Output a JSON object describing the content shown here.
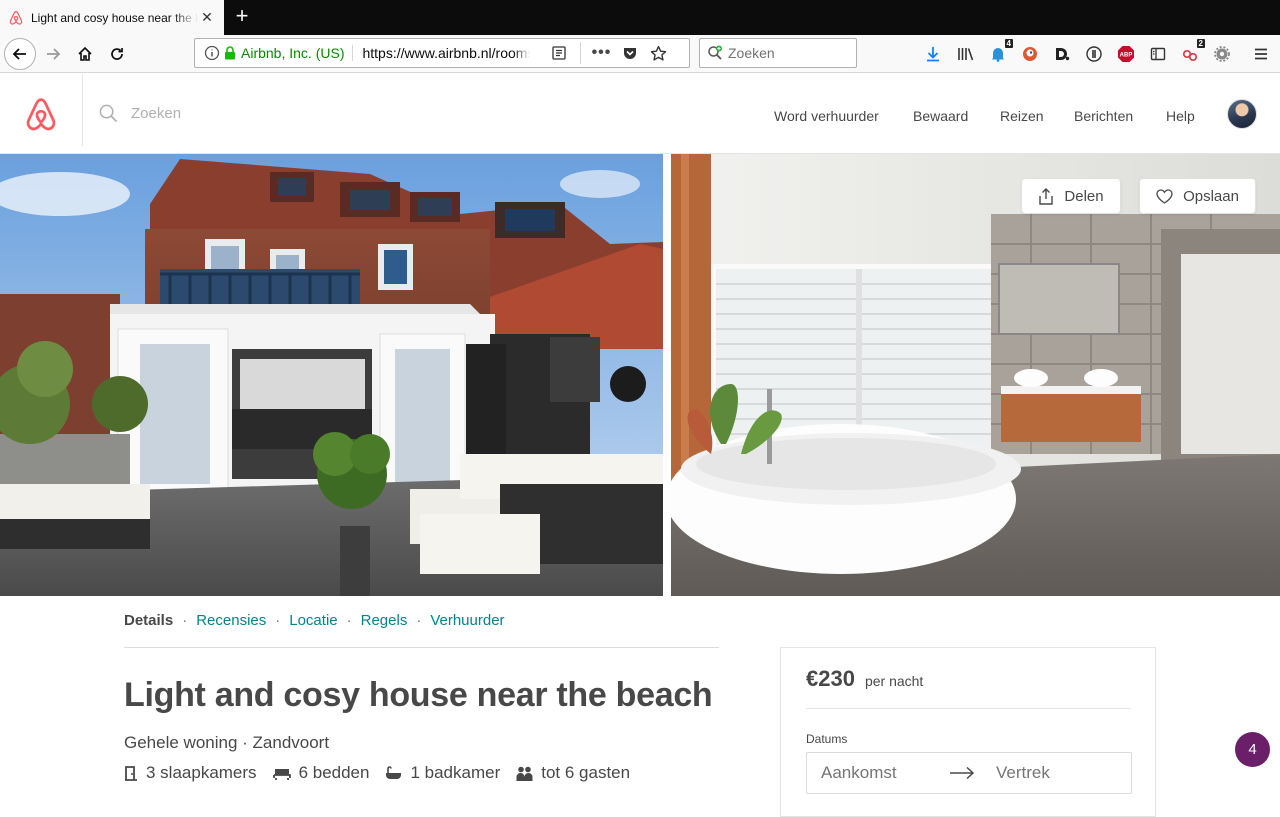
{
  "browser": {
    "tab_title": "Light and cosy house near the beach",
    "tab_close": "✕",
    "new_tab": "+",
    "identity": "Airbnb, Inc. (US)",
    "url": "https://www.airbnb.nl/rooms/",
    "more": "•••",
    "search_placeholder": "Zoeken",
    "badges": {
      "ext_a": "4",
      "ext_b": "2"
    }
  },
  "header": {
    "search_placeholder": "Zoeken",
    "nav": [
      "Word verhuurder",
      "Bewaard",
      "Reizen",
      "Berichten",
      "Help"
    ]
  },
  "photos": {
    "share_label": "Delen",
    "save_label": "Opslaan"
  },
  "listing": {
    "subnav": {
      "details": "Details",
      "reviews": "Recensies",
      "location": "Locatie",
      "rules": "Regels",
      "host": "Verhuurder",
      "separator": "·"
    },
    "title": "Light and cosy house near the beach",
    "type": "Gehele woning",
    "location": " · Zandvoort",
    "amenities": {
      "bedrooms": "3 slaapkamers",
      "beds": "6 bedden",
      "baths": "1 badkamer",
      "guests": "tot 6 gasten"
    }
  },
  "booking": {
    "price": "€230",
    "per_night": "per nacht",
    "dates_label": "Datums",
    "checkin": "Aankomst",
    "checkout": "Vertrek"
  },
  "help_badge": "4",
  "colors": {
    "brand": "#ff5a5f",
    "link": "#008489",
    "text": "#484848",
    "help": "#6b1f68"
  }
}
